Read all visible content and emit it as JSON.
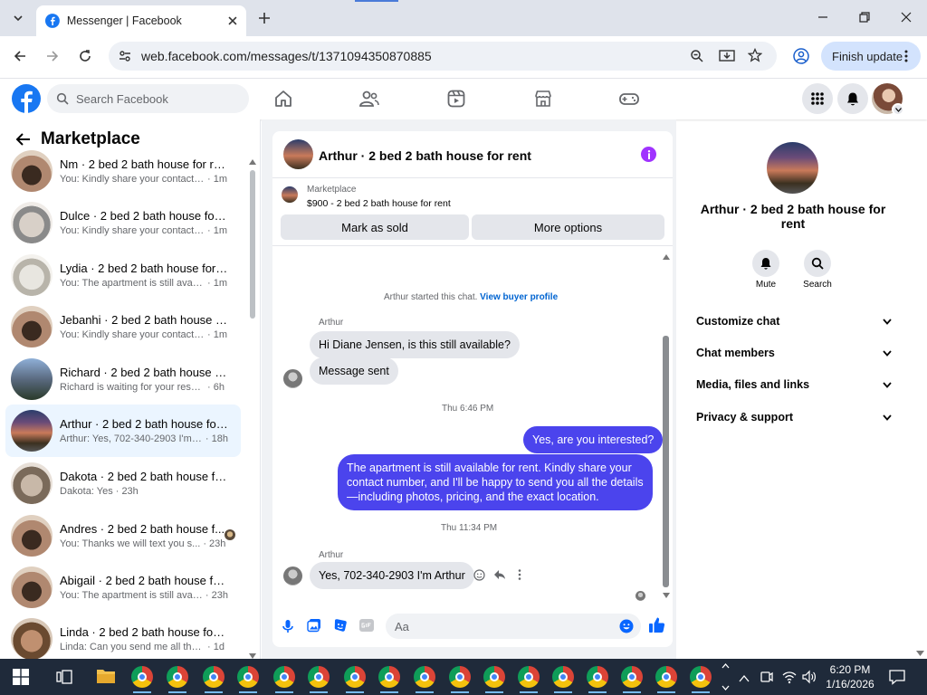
{
  "browser": {
    "tab_title": "Messenger | Facebook",
    "url": "web.facebook.com/messages/t/1371094350870885",
    "finish_update_label": "Finish update"
  },
  "fb_header": {
    "search_placeholder": "Search Facebook"
  },
  "left": {
    "title": "Marketplace",
    "chats": [
      {
        "title": "Nm · 2 bed 2 bath house for rent",
        "snippet": "You: Kindly share your contact nu...",
        "time": "· 1m"
      },
      {
        "title": "Dulce · 2 bed 2 bath house for r...",
        "snippet": "You: Kindly share your contact nu...",
        "time": "· 1m"
      },
      {
        "title": "Lydia · 2 bed 2 bath house for r...",
        "snippet": "You: The apartment is still availabl...",
        "time": "· 1m"
      },
      {
        "title": "Jebanhi · 2 bed 2 bath house fo...",
        "snippet": "You: Kindly share your contact nu...",
        "time": "· 1m"
      },
      {
        "title": "Richard · 2 bed 2 bath house fo...",
        "snippet": "Richard is waiting for your response.",
        "time": "· 6h"
      },
      {
        "title": "Arthur · 2 bed 2 bath house for ...",
        "snippet": "Arthur: Yes, 702-340-2903 I'm Art...",
        "time": "· 18h"
      },
      {
        "title": "Dakota · 2 bed 2 bath house for...",
        "snippet": "Dakota: Yes",
        "time": "· 23h"
      },
      {
        "title": "Andres · 2 bed 2 bath house f...",
        "snippet": "You: Thanks we will text you s...",
        "time": "· 23h"
      },
      {
        "title": "Abigail · 2 bed 2 bath house for...",
        "snippet": "You: The apartment is still availabl...",
        "time": "· 23h"
      },
      {
        "title": "Linda · 2 bed 2 bath house for r...",
        "snippet": "Linda: Can you send me all the det...",
        "time": "· 1d"
      }
    ]
  },
  "chat": {
    "title": "Arthur · 2 bed 2 bath house for rent",
    "listing_source": "Marketplace",
    "listing_text": "$900 - 2 bed 2 bath house for rent",
    "mark_sold_label": "Mark as sold",
    "more_options_label": "More options",
    "started_text": "Arthur started this chat.",
    "view_profile_link": "View buyer profile",
    "sender1": "Arthur",
    "msg1": "Hi Diane Jensen, is this still available?",
    "msg2": "Message sent",
    "time1": "Thu 6:46 PM",
    "out1": "Yes, are you interested?",
    "out2": "The apartment is still available for rent. Kindly share your contact number, and I'll be happy to send you all the details—including photos, pricing, and the exact location.",
    "time2": "Thu 11:34 PM",
    "sender2": "Arthur",
    "msg3": "Yes, 702-340-2903 I'm Arthur",
    "composer_placeholder": "Aa",
    "accent_color": "#4b44ed"
  },
  "right": {
    "title": "Arthur · 2 bed 2 bath house for rent",
    "mute_label": "Mute",
    "search_label": "Search",
    "sections": [
      {
        "label": "Customize chat"
      },
      {
        "label": "Chat members"
      },
      {
        "label": "Media, files and links"
      },
      {
        "label": "Privacy & support"
      }
    ]
  },
  "taskbar": {
    "time": "6:20 PM",
    "date": "1/16/2026"
  }
}
